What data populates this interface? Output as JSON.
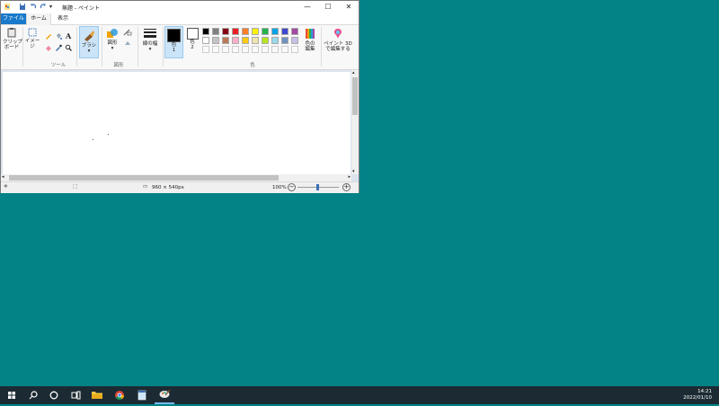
{
  "window": {
    "title": "無題 - ペイント",
    "minimize_icon": "minimize-icon",
    "maximize_icon": "maximize-icon",
    "close_icon": "close-icon"
  },
  "tabs": [
    {
      "label": "ファイル"
    },
    {
      "label": "ホーム"
    },
    {
      "label": "表示"
    }
  ],
  "ribbon": {
    "clipboard_label": "クリップ\nボード",
    "image_label": "イメージ",
    "tools_group": "ツール",
    "brush_label": "ブラシ",
    "shapes_label": "図形",
    "shapes_group": "図形",
    "size_label": "線の幅",
    "color1_label": "色\n1",
    "color2_label": "色\n2",
    "colors_group": "色",
    "edit_colors_label": "色の\n編集",
    "paint3d_label": "ペイント 3D\nで編集する",
    "palette_row1": [
      "#000000",
      "#7f7f7f",
      "#880015",
      "#ed1c24",
      "#ff7f27",
      "#fff200",
      "#22b14c",
      "#00a2e8",
      "#3f48cc",
      "#a349a4"
    ],
    "palette_row2": [
      "#ffffff",
      "#c3c3c3",
      "#b97a57",
      "#ffaec9",
      "#ffc90e",
      "#efe4b0",
      "#b5e61d",
      "#99d9ea",
      "#7092be",
      "#c8bfe7"
    ],
    "color1": "#000000",
    "color2": "#ffffff"
  },
  "status": {
    "canvas_size": "960 × 540px",
    "zoom": "100%"
  },
  "taskbar": {
    "time": "14:21",
    "date": "2022/01/10"
  }
}
